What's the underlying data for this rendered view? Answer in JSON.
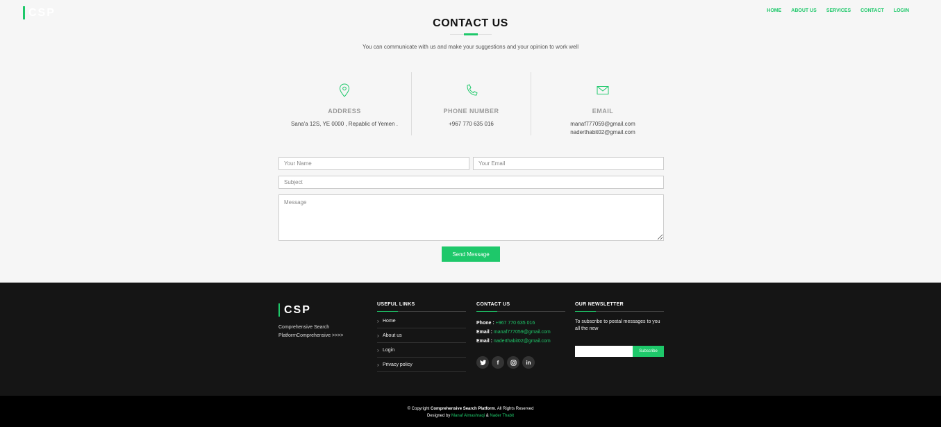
{
  "header": {
    "brand": "CSP",
    "nav": [
      "HOME",
      "ABOUT US",
      "SERVICES",
      "CONTACT",
      "LOGIN"
    ]
  },
  "contact": {
    "title": "CONTACT US",
    "subtitle": "You can communicate with us and make your suggestions and your opinion to work well",
    "address": {
      "label": "ADDRESS",
      "value": "Sana'a 12S, YE 0000 , Repablic of Yemen ."
    },
    "phone": {
      "label": "PHONE NUMBER",
      "value": "+967 770 635 016"
    },
    "email": {
      "label": "EMAIL",
      "value1": "manaf777059@gmail.com",
      "value2": "naderthabit02@gmail.com"
    }
  },
  "form": {
    "name_placeholder": "Your Name",
    "email_placeholder": "Your Email",
    "subject_placeholder": "Subject",
    "message_placeholder": "Message",
    "send_label": "Send Message"
  },
  "footer": {
    "brand": "CSP",
    "description": "Comprehensive Search PlatformComprehensive >>>>",
    "links_title": "USEFUL LINKS",
    "links": [
      "Home",
      "About us",
      "Login",
      "Privacy policy"
    ],
    "contact_title": "CONTACT US",
    "phone_label": "Phone :",
    "phone_value": "+967 770 635 016",
    "email_label": "Email :",
    "email1": "manaf777059@gmail.com",
    "email2": "naderthabit02@gmail.com",
    "social_icons": [
      "twitter-icon",
      "facebook-icon",
      "instagram-icon",
      "linkedin-icon"
    ],
    "news_title": "OUR NEWSLETTER",
    "news_text": "To subscribe to postal messages to you all the new",
    "subscribe_label": "Subscribe"
  },
  "bottom": {
    "copyright_prefix": "© Copyright",
    "copyright_name": "Comprehensive Search Platform",
    "copyright_suffix": ". All Rights Reserved",
    "designed_by": "Designed by",
    "designer1": "Manaf Almashraqi",
    "and": "&",
    "designer2": "Nader Thabit"
  },
  "colors": {
    "accent": "#1ec86a",
    "footer_bg": "#151515",
    "page_bg": "#f6f6f6"
  }
}
